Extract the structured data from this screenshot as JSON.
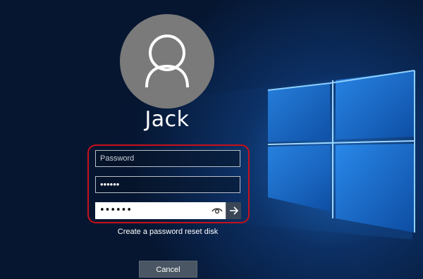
{
  "user": {
    "name": "Jack",
    "avatar_icon": "user-silhouette-icon"
  },
  "login": {
    "password_placeholder": "Password",
    "password_field_2": "••••••",
    "password_field_3": "••••••",
    "reveal_icon": "eye-icon",
    "submit_icon": "arrow-right-icon",
    "highlight_color": "#c8101a"
  },
  "links": {
    "reset": "Create a password reset disk"
  },
  "actions": {
    "cancel": "Cancel"
  },
  "colors": {
    "background": "#071a33",
    "windows_logo": "#1e7fe0"
  }
}
